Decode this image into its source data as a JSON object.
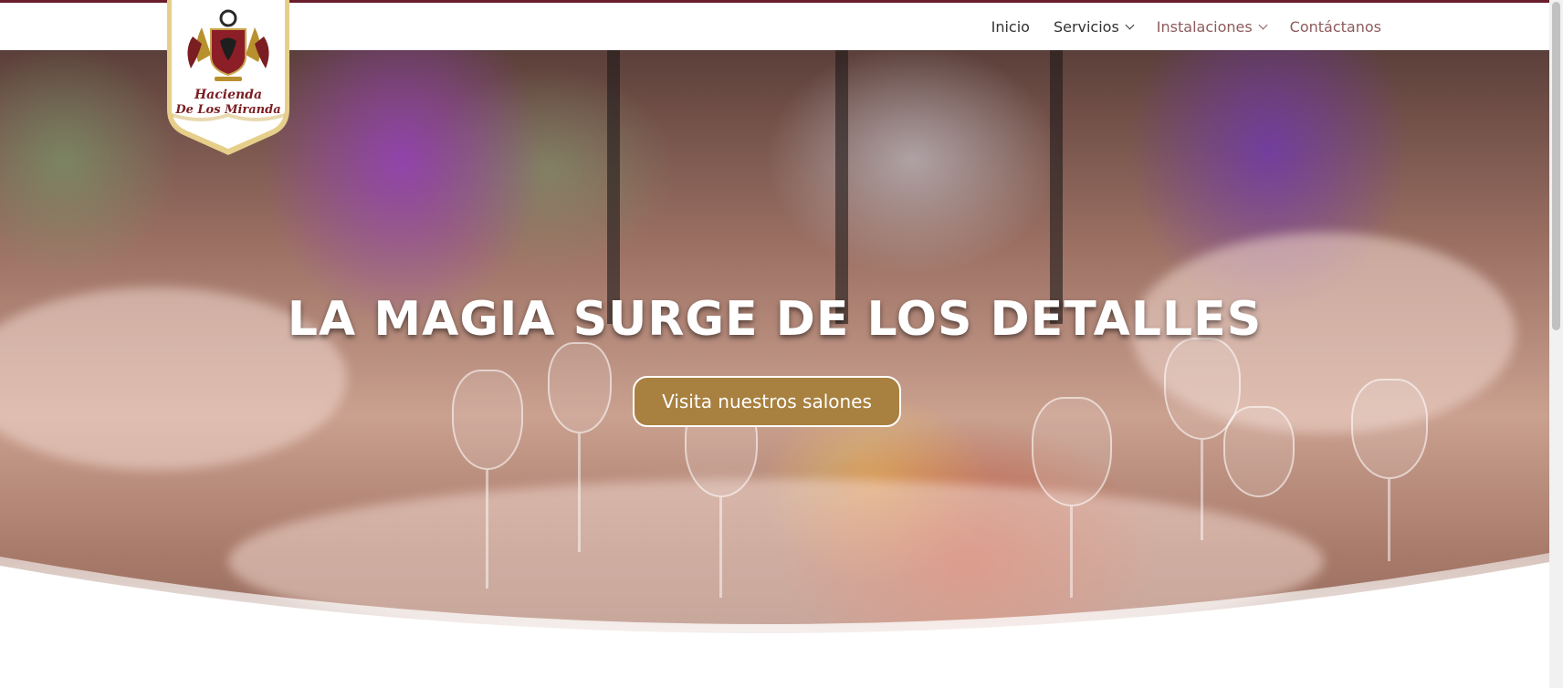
{
  "brand": {
    "name_line1": "Hacienda",
    "name_line2": "De Los Miranda",
    "accent_color": "#6b1d2c",
    "gold_color": "#a8803f"
  },
  "nav": {
    "items": [
      {
        "label": "Inicio",
        "has_dropdown": false
      },
      {
        "label": "Servicios",
        "has_dropdown": true
      },
      {
        "label": "Instalaciones",
        "has_dropdown": true
      },
      {
        "label": "Contáctanos",
        "has_dropdown": false
      }
    ]
  },
  "hero": {
    "title": "LA MAGIA SURGE DE LOS DETALLES",
    "cta_label": "Visita nuestros salones"
  }
}
